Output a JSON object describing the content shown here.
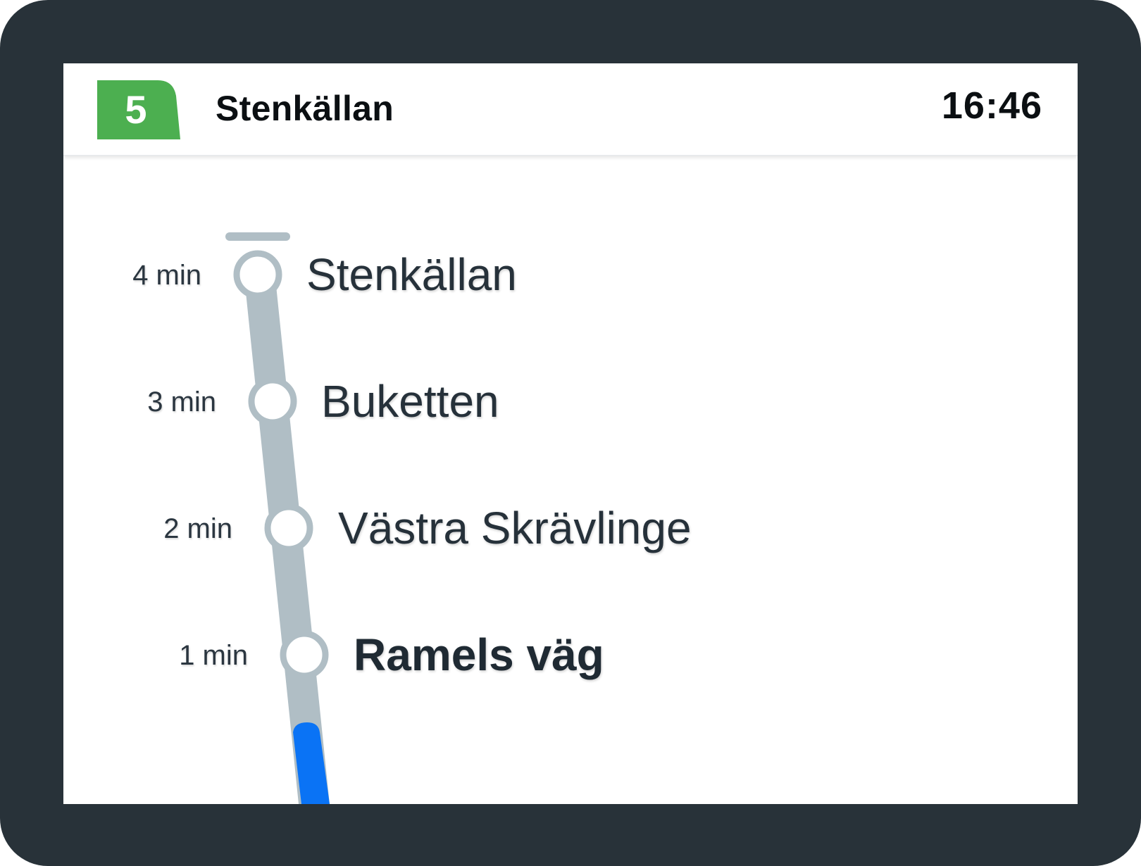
{
  "header": {
    "line_number": "5",
    "line_color": "#4caf50",
    "destination": "Stenkällan",
    "clock": "16:46"
  },
  "route": {
    "line_color": "#b0bec5",
    "progress_color": "#0a73f5",
    "stops": [
      {
        "time": "4 min",
        "name": "Stenkällan"
      },
      {
        "time": "3 min",
        "name": "Buketten"
      },
      {
        "time": "2 min",
        "name": "Västra Skrävlinge"
      },
      {
        "time": "1 min",
        "name": "Ramels väg",
        "next": true
      }
    ]
  }
}
